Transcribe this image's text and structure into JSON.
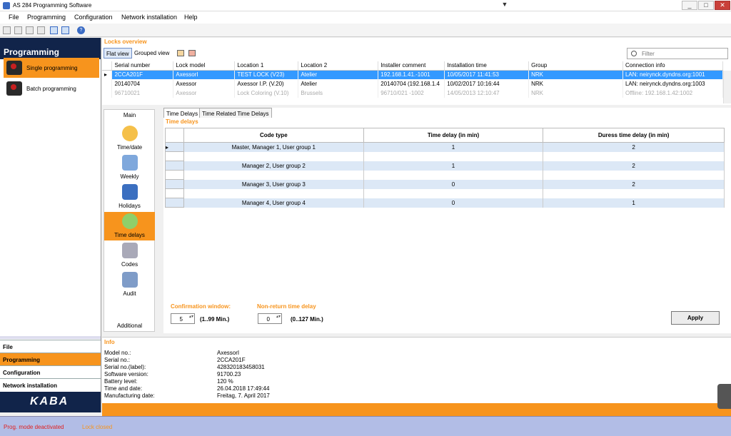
{
  "window": {
    "title": "AS 284 Programming Software",
    "minimize": "_",
    "maximize": "□",
    "close": "✕",
    "extra": "▼"
  },
  "menu": [
    "File",
    "Programming",
    "Configuration",
    "Network installation",
    "Help"
  ],
  "sidebar": {
    "title": "Programming",
    "options": [
      "Single programming",
      "Batch programming"
    ],
    "nav": [
      "File",
      "Programming",
      "Configuration",
      "Network installation"
    ],
    "logo": "KABA"
  },
  "overview": {
    "title": "Locks overview",
    "flat_view": "Flat view",
    "grouped_view": "Grouped view",
    "filter_placeholder": "Filter",
    "columns": [
      "Serial number",
      "Lock model",
      "Location 1",
      "Location 2",
      "Installer comment",
      "Installation time",
      "Group",
      "Connection info"
    ],
    "rows": [
      [
        "2CCA201F",
        "AxessorI",
        "TEST LOCK (V23)",
        "Atelier",
        "192.168.1.41.-1001",
        "10/05/2017 11:41:53",
        "NRK",
        "LAN: neirynck.dyndns.org:1001"
      ],
      [
        "20140704",
        "Axessor",
        "Axessor I.P. (V.20)",
        "Atelier",
        "20140704 (192.168.1.4",
        "10/02/2017 10:16:44",
        "NRK",
        "LAN: neirynck.dyndns.org:1003"
      ],
      [
        "96710021",
        "Axessor",
        "Lock Coloring (V.10)",
        "Brussels",
        "96710/021 -1002",
        "14/05/2013 12:10:47",
        "NRK",
        "Offline: 192.168.1.42:1002"
      ]
    ]
  },
  "functions": {
    "main_label": "Main",
    "additional_label": "Additional",
    "items": [
      "Time/date",
      "Weekly",
      "Holidays",
      "Time delays",
      "Codes",
      "Audit"
    ]
  },
  "time_delays": {
    "tabs": [
      "Time Delays",
      "Time Related Time Delays"
    ],
    "section_title": "Time delays",
    "columns": [
      "Code type",
      "Time delay (in min)",
      "Duress time delay (in min)"
    ],
    "rows": [
      [
        "Master, Manager 1, User group 1",
        "1",
        "2"
      ],
      [
        "Manager 2, User group 2",
        "1",
        "2"
      ],
      [
        "Manager 3, User group 3",
        "0",
        "2"
      ],
      [
        "Manager 4, User group 4",
        "0",
        "1"
      ]
    ],
    "confirmation_label": "Confirmation window:",
    "confirmation_value": "5",
    "confirmation_range": "(1..99 Min.)",
    "nonreturn_label": "Non-return time delay",
    "nonreturn_value": "0",
    "nonreturn_range": "(0..127 Min.)",
    "apply": "Apply"
  },
  "info": {
    "title": "Info",
    "labels": [
      "Model no.:",
      "Serial no.:",
      "Serial no.(label):",
      "Software version:",
      "Battery level:",
      "Time and date:",
      "Manufacturing date:"
    ],
    "values": [
      "AxessorI",
      "2CCA201F",
      "428320183458031",
      "91700.23",
      "120 %",
      "26.04.2018 17:49:44",
      "Freitag, 7. April 2017"
    ]
  },
  "status": {
    "prog_mode": "Prog. mode deactivated",
    "lock": "Lock closed"
  },
  "colors": {
    "accent": "#f7941d",
    "navy": "#11244a",
    "selection": "#3399ff",
    "status_red": "#e02020"
  }
}
